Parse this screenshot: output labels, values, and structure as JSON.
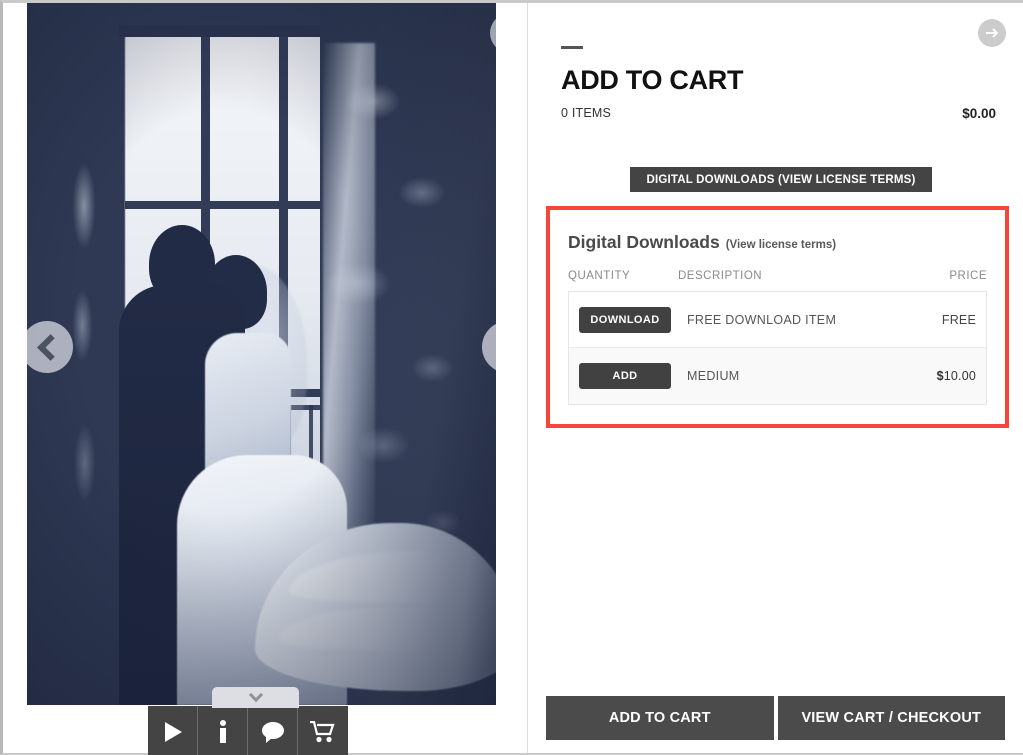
{
  "photo_viewer": {
    "alt_description": "Bride and groom silhouette embracing by a tall window with long wedding dress train",
    "prev_icon": "chevron-left-icon",
    "next_icon": "chevron-right-icon",
    "close_icon": "close-icon",
    "expand_icon": "chevron-down-icon",
    "toolbar": [
      {
        "name": "slideshow",
        "icon": "play-icon"
      },
      {
        "name": "info",
        "icon": "info-icon"
      },
      {
        "name": "comment",
        "icon": "comment-icon"
      },
      {
        "name": "cart",
        "icon": "shopping-cart-icon"
      }
    ]
  },
  "cart": {
    "next_icon": "arrow-right-icon",
    "title": "ADD TO CART",
    "items_label": "0 ITEMS",
    "total": "$0.00",
    "license_button": "DIGITAL DOWNLOADS (VIEW LICENSE TERMS)",
    "downloads": {
      "heading": "Digital Downloads",
      "heading_sub": "(View license terms)",
      "columns": {
        "quantity": "QUANTITY",
        "description": "DESCRIPTION",
        "price": "PRICE"
      },
      "rows": [
        {
          "button": "DOWNLOAD",
          "description": "FREE DOWNLOAD ITEM",
          "price": "FREE",
          "price_currency": "",
          "price_amount": "FREE"
        },
        {
          "button": "ADD",
          "description": "MEDIUM",
          "price": "$10.00",
          "price_currency": "$",
          "price_amount": "10.00"
        }
      ]
    },
    "actions": {
      "add_to_cart": "ADD TO CART",
      "view_cart": "VIEW CART / CHECKOUT"
    }
  },
  "colors": {
    "photo_background": "#2f3954",
    "highlight_border": "#f8453c",
    "button_dark": "#414141",
    "action_button": "#4b4b4b",
    "toolbar_dark": "#444444"
  }
}
